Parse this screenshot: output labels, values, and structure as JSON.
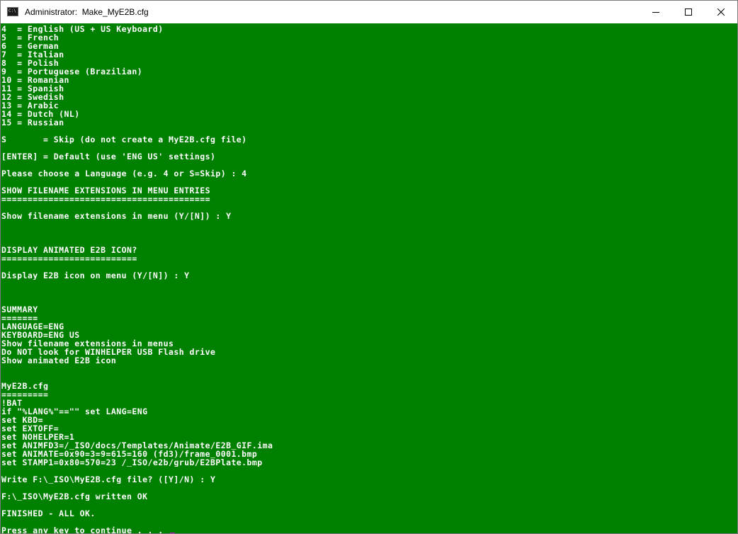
{
  "window": {
    "title": "Administrator:  Make_MyE2B.cfg",
    "icon_prompt": "C:\\",
    "icon": "console-icon",
    "controls": [
      "minimize-icon",
      "maximize-icon",
      "close-icon"
    ]
  },
  "colors": {
    "console_background": "#008000",
    "console_text": "#ffffff",
    "cursor": "#c000c0"
  },
  "console": {
    "lines": [
      "4  = English (US + US Keyboard)",
      "5  = French",
      "6  = German",
      "7  = Italian",
      "8  = Polish",
      "9  = Portuguese (Brazilian)",
      "10 = Romanian",
      "11 = Spanish",
      "12 = Swedish",
      "13 = Arabic",
      "14 = Dutch (NL)",
      "15 = Russian",
      "",
      "S       = Skip (do not create a MyE2B.cfg file)",
      "",
      "[ENTER] = Default (use 'ENG US' settings)",
      "",
      "Please choose a Language (e.g. 4 or S=Skip) : 4",
      "",
      "SHOW FILENAME EXTENSIONS IN MENU ENTRIES",
      "========================================",
      "",
      "Show filename extensions in menu (Y/[N]) : Y",
      "",
      "",
      "",
      "DISPLAY ANIMATED E2B ICON?",
      "==========================",
      "",
      "Display E2B icon on menu (Y/[N]) : Y",
      "",
      "",
      "",
      "SUMMARY",
      "=======",
      "LANGUAGE=ENG",
      "KEYBOARD=ENG US",
      "Show filename extensions in menus",
      "Do NOT look for WINHELPER USB Flash drive",
      "Show animated E2B icon",
      "",
      "",
      "MyE2B.cfg",
      "=========",
      "!BAT",
      "if \"%LANG%\"==\"\" set LANG=ENG",
      "set KBD=",
      "set EXTOFF=",
      "set NOHELPER=1",
      "set ANIMFD3=/_ISO/docs/Templates/Animate/E2B_GIF.ima",
      "set ANIMATE=0x90=3=9=615=160 (fd3)/frame_0001.bmp",
      "set STAMP1=0x80=570=23 /_ISO/e2b/grub/E2BPlate.bmp",
      "",
      "Write F:\\_ISO\\MyE2B.cfg file? ([Y]/N) : Y",
      "",
      "F:\\_ISO\\MyE2B.cfg written OK",
      "",
      "FINISHED - ALL OK.",
      "",
      "Press any key to continue . . . "
    ]
  }
}
